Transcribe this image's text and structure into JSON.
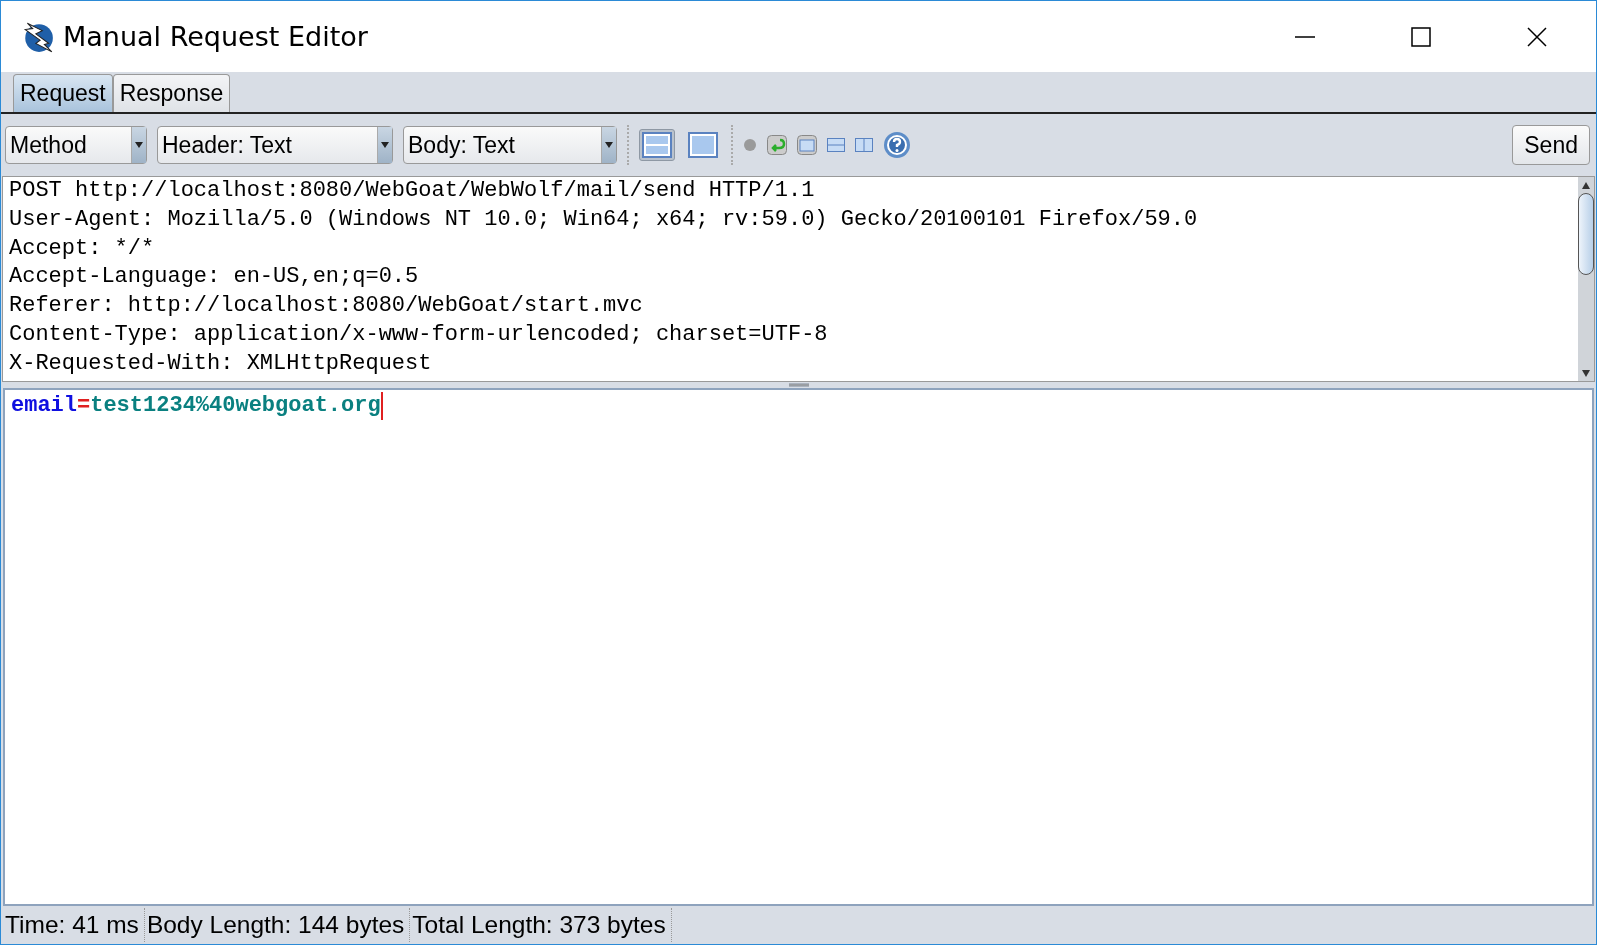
{
  "window": {
    "title": "Manual Request Editor"
  },
  "tabs": [
    {
      "label": "Request",
      "selected": true
    },
    {
      "label": "Response",
      "selected": false
    }
  ],
  "toolbar": {
    "dropdowns": [
      "Method",
      "Header: Text",
      "Body: Text"
    ],
    "layout_buttons": [
      {
        "selected": true
      },
      {
        "selected": false
      }
    ],
    "send_label": "Send"
  },
  "header_lines": [
    "POST http://localhost:8080/WebGoat/WebWolf/mail/send HTTP/1.1",
    "User-Agent: Mozilla/5.0 (Windows NT 10.0; Win64; x64; rv:59.0) Gecko/20100101 Firefox/59.0",
    "Accept: */*",
    "Accept-Language: en-US,en;q=0.5",
    "Referer: http://localhost:8080/WebGoat/start.mvc",
    "Content-Type: application/x-www-form-urlencoded; charset=UTF-8",
    "X-Requested-With: XMLHttpRequest"
  ],
  "body_tokens": [
    {
      "kind": "key",
      "text": "email"
    },
    {
      "kind": "equals",
      "text": "="
    },
    {
      "kind": "value",
      "text": "test1234%40webgoat.org"
    }
  ],
  "status_bar": [
    "Time: 41 ms",
    "Body Length: 144 bytes",
    "Total Length: 373 bytes"
  ]
}
